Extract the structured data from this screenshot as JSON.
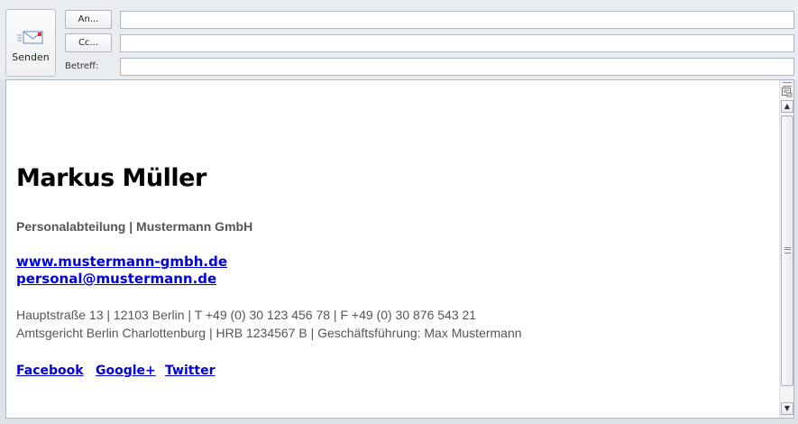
{
  "header": {
    "send_label": "Senden",
    "to_label": "An...",
    "cc_label": "Cc...",
    "subject_label": "Betreff:",
    "to_value": "",
    "cc_value": "",
    "subject_value": ""
  },
  "signature": {
    "name": "Markus Müller",
    "department": "Personalabteilung | Mustermann GmbH",
    "website": "www.mustermann-gmbh.de",
    "email": "personal@mustermann.de",
    "address_line": "Hauptstraße 13 | 12103 Berlin | T +49 (0) 30 123 456 78 | F +49 (0) 30 876 543 21",
    "legal_line": "Amtsgericht Berlin Charlottenburg | HRB 1234567 B | Geschäftsführung: Max Mustermann",
    "social": [
      "Facebook",
      "Google+",
      "Twitter"
    ]
  },
  "colors": {
    "link": "#0000dd",
    "muted_text": "#555555",
    "toolbar_bg": "#e9ecf0"
  },
  "icons": {
    "send": "envelope-icon",
    "scroll_up": "scroll-up-arrow",
    "scroll_down": "scroll-down-arrow",
    "ruler": "ruler-toggle-icon"
  }
}
